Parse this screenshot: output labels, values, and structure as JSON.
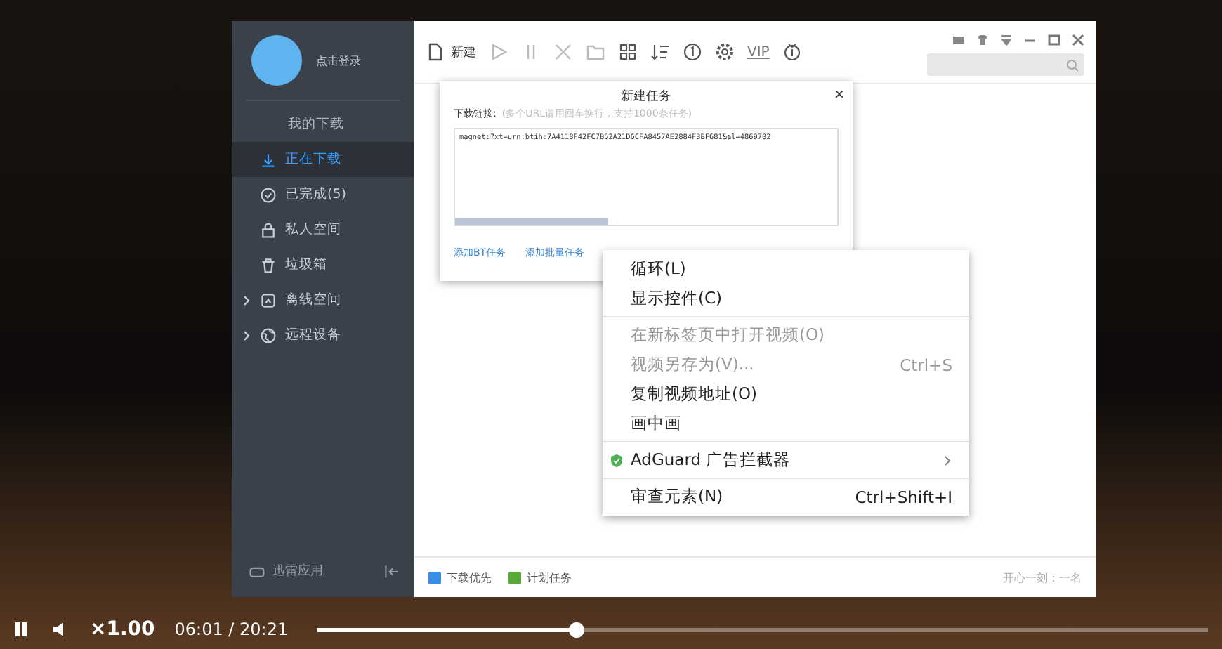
{
  "app": {
    "sidebar": {
      "user": "点击登录",
      "section": "我的下载",
      "items": [
        {
          "label": "正在下载",
          "selected": true,
          "kind": "item"
        },
        {
          "label": "已完成(5)",
          "selected": false,
          "kind": "item"
        },
        {
          "label": "私人空间",
          "selected": false,
          "kind": "item"
        },
        {
          "label": "垃圾箱",
          "selected": false,
          "kind": "item"
        },
        {
          "label": "离线空间",
          "selected": false,
          "kind": "group"
        },
        {
          "label": "远程设备",
          "selected": false,
          "kind": "group"
        }
      ],
      "bottom": "迅雷应用"
    },
    "toolbar": {
      "new": "新建",
      "vip": "VIP"
    },
    "dialog": {
      "title": "新建任务",
      "close": "×",
      "field_label": "下载链接:",
      "hint": "(多个URL请用回车换行，支持1000条任务)",
      "value": "magnet:?xt=urn:btih:7A4118F42FC7B52A21D6CFA8457AE2884F3BF681&al=4869702",
      "links": [
        "添加BT任务",
        "添加批量任务"
      ]
    },
    "status_bar": {
      "items": [
        "下载优先",
        "计划任务"
      ],
      "message": "开心一刻：一名"
    }
  },
  "context_menu": [
    {
      "kind": "item",
      "label": "循环(L)",
      "disabled": false
    },
    {
      "kind": "item",
      "label": "显示控件(C)",
      "disabled": false
    },
    {
      "kind": "separator"
    },
    {
      "kind": "item",
      "label": "在新标签页中打开视频(O)",
      "disabled": true
    },
    {
      "kind": "item",
      "label": "视频另存为(V)...",
      "shortcut": "Ctrl+S",
      "disabled": true
    },
    {
      "kind": "item",
      "label": "复制视频地址(O)",
      "disabled": false
    },
    {
      "kind": "item",
      "label": "画中画",
      "disabled": false
    },
    {
      "kind": "separator"
    },
    {
      "kind": "submenu",
      "label": "AdGuard 广告拦截器",
      "disabled": false
    },
    {
      "kind": "separator"
    },
    {
      "kind": "item",
      "label": "审查元素(N)",
      "shortcut": "Ctrl+Shift+I",
      "disabled": false
    }
  ],
  "player": {
    "speed": "×1.00",
    "time": "06:01 / 20:21",
    "level": 0.29
  }
}
